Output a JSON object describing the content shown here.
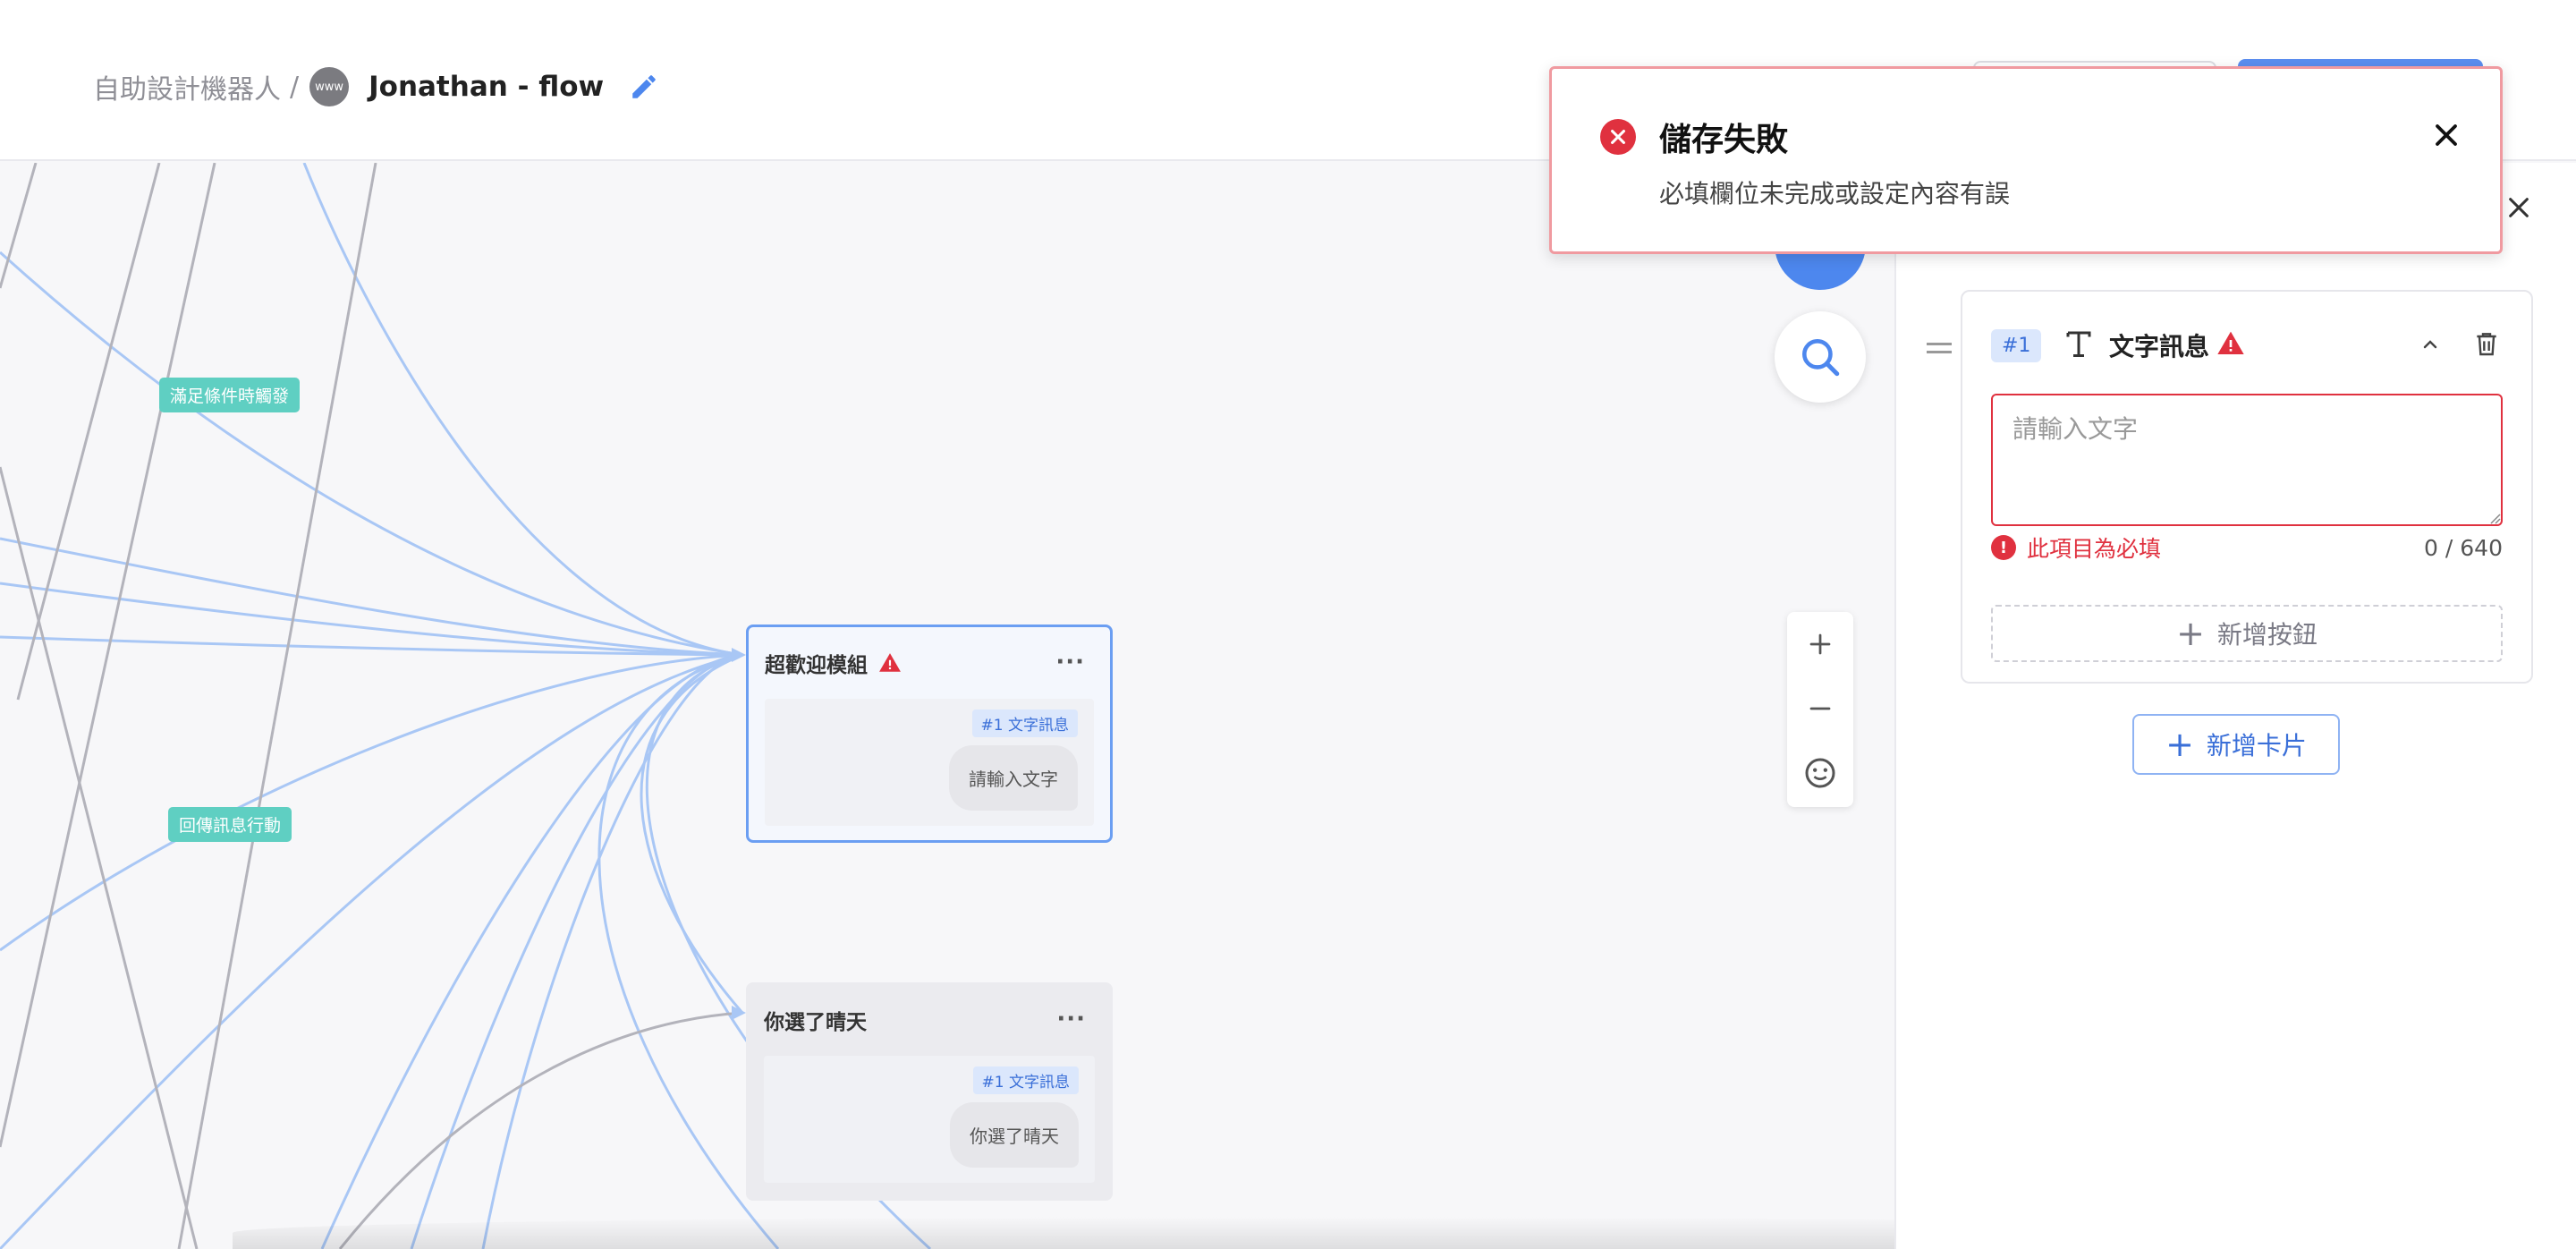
{
  "header": {
    "breadcrumb_parent": "自助設計機器人",
    "breadcrumb_separator": "/",
    "site_icon_text": "www",
    "flow_title": "Jonathan - flow"
  },
  "canvas": {
    "edge_labels": [
      "滿足條件時觸發",
      "回傳訊息行動"
    ],
    "nodes": [
      {
        "title": "超歡迎模組",
        "more": "···",
        "tag": "#1 文字訊息",
        "bubble": "請輸入文字",
        "has_warning": true
      },
      {
        "title": "你選了晴天",
        "more": "···",
        "tag": "#1 文字訊息",
        "bubble": "你選了晴天",
        "has_warning": false
      }
    ],
    "zoom_controls": [
      "plus-icon",
      "minus-icon",
      "fit-view-icon"
    ]
  },
  "panel": {
    "card": {
      "badge": "#1",
      "type_label": "文字訊息",
      "textarea_placeholder": "請輸入文字",
      "textarea_value": "",
      "error_icon": "!",
      "error_text": "此項目為必填",
      "char_count": "0 / 640",
      "add_button_plus": "+",
      "add_button_label": "新增按鈕"
    },
    "add_card_plus": "+",
    "add_card_label": "新增卡片"
  },
  "toast": {
    "title": "儲存失敗",
    "message": "必填欄位未完成或設定內容有誤"
  },
  "colors": {
    "accent": "#4d87ee",
    "error": "#e0313f",
    "edge_blue": "#a9c7f5",
    "edge_gray": "#b3b3bb",
    "edge_label_bg": "#5fcfc2"
  }
}
